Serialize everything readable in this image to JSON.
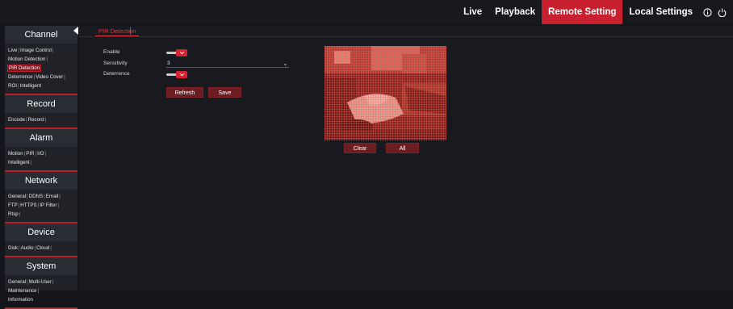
{
  "topnav": {
    "items": [
      {
        "label": "Live",
        "active": false
      },
      {
        "label": "Playback",
        "active": false
      },
      {
        "label": "Remote Setting",
        "active": true
      },
      {
        "label": "Local Settings",
        "active": false
      }
    ],
    "icons": [
      "info-icon",
      "power-icon"
    ],
    "accent_color": "#c9202f"
  },
  "sidebar": {
    "sections": [
      {
        "title": "Channel",
        "rows": [
          [
            "Live",
            "Image Control"
          ],
          [
            "Motion Detection"
          ],
          [
            "PIR Detection"
          ],
          [
            "Deterrence",
            "Video Cover"
          ],
          [
            "ROI",
            "Intelligent"
          ]
        ]
      },
      {
        "title": "Record",
        "rows": [
          [
            "Encode",
            "Record"
          ]
        ]
      },
      {
        "title": "Alarm",
        "rows": [
          [
            "Motion",
            "PIR",
            "I/O"
          ],
          [
            "Intelligent"
          ]
        ]
      },
      {
        "title": "Network",
        "rows": [
          [
            "General",
            "DDNS",
            "Email"
          ],
          [
            "FTP",
            "HTTPS",
            "IP Filter"
          ],
          [
            "Rtsp"
          ]
        ]
      },
      {
        "title": "Device",
        "rows": [
          [
            "Disk",
            "Audio",
            "Cloud"
          ]
        ]
      },
      {
        "title": "System",
        "rows": [
          [
            "General",
            "Multi-User"
          ],
          [
            "Maintenance"
          ],
          [
            "Information"
          ]
        ]
      }
    ],
    "selected": "PIR Detection"
  },
  "tab": {
    "label": "PIR Detection"
  },
  "form": {
    "enable": {
      "label": "Enable",
      "on": true
    },
    "sensitivity": {
      "label": "Sensitivity",
      "value": "3"
    },
    "deterrence": {
      "label": "Deterrence",
      "on": true
    }
  },
  "buttons": {
    "refresh": "Refresh",
    "save": "Save",
    "clear": "Clear",
    "all": "All"
  },
  "preview": {
    "icon": "camera-preview-image",
    "overlay_color": "#c4352c"
  }
}
